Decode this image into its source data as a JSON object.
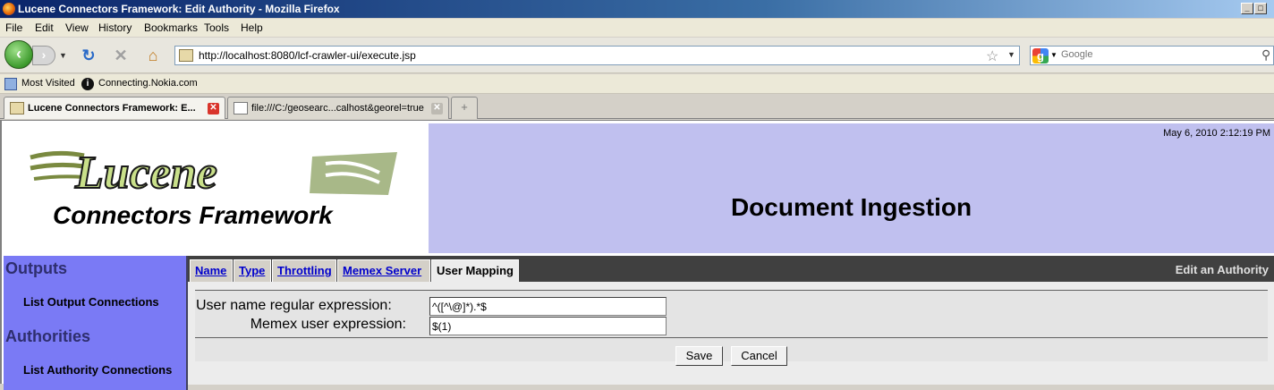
{
  "window": {
    "title": "Lucene Connectors Framework: Edit Authority - Mozilla Firefox"
  },
  "menu": [
    "File",
    "Edit",
    "View",
    "History",
    "Bookmarks",
    "Tools",
    "Help"
  ],
  "navbar": {
    "url": "http://localhost:8080/lcf-crawler-ui/execute.jsp",
    "search_placeholder": "Google"
  },
  "bookmarks": [
    "Most Visited",
    "Connecting.Nokia.com"
  ],
  "browser_tabs": [
    {
      "label": "Lucene Connectors Framework: E..."
    },
    {
      "label": "file:///C:/geosearc...calhost&georel=true"
    }
  ],
  "page": {
    "logo_text_top": "Lucene",
    "logo_text_bottom": "Connectors Framework",
    "timestamp": "May 6, 2010 2:12:19 PM",
    "heading": "Document Ingestion",
    "sidebar": {
      "outputs_title": "Outputs",
      "outputs_link": "List Output Connections",
      "authorities_title": "Authorities",
      "authorities_link": "List Authority Connections"
    },
    "tabs": [
      "Name",
      "Type",
      "Throttling",
      "Memex Server",
      "User Mapping"
    ],
    "active_tab": "User Mapping",
    "page_context": "Edit an Authority",
    "form": {
      "regex_label": "User name regular expression:",
      "regex_value": "^([^\\@]*).*$",
      "memex_label": "Memex user expression:",
      "memex_value": "$(1)",
      "save_label": "Save",
      "cancel_label": "Cancel"
    }
  }
}
